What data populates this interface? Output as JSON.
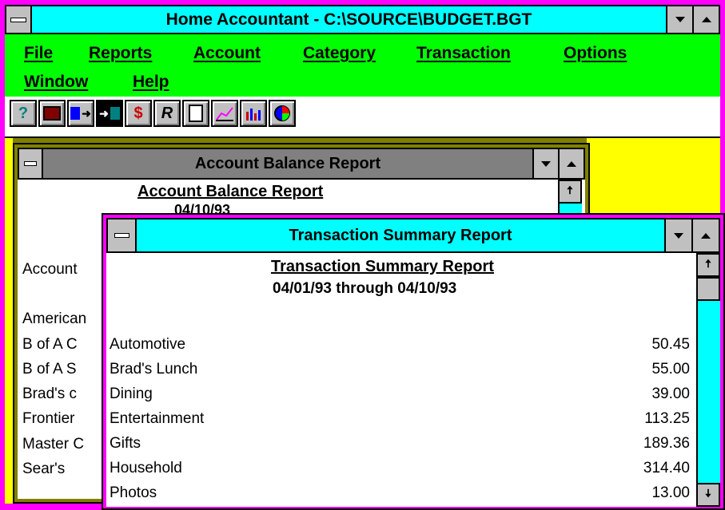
{
  "app": {
    "title": "Home Accountant - C:\\SOURCE\\BUDGET.BGT",
    "menu": [
      "File",
      "Reports",
      "Account",
      "Category",
      "Transaction",
      "Options",
      "Window",
      "Help"
    ],
    "toolbar": [
      "help-icon",
      "save-icon",
      "export-icon",
      "import-icon",
      "dollar-icon",
      "reconcile-icon",
      "report-icon",
      "line-chart-icon",
      "bar-chart-icon",
      "pie-chart-icon"
    ],
    "toolbar_glyphs": [
      "?",
      "",
      "",
      "",
      "$",
      "R",
      "",
      "",
      "",
      ""
    ]
  },
  "account_window": {
    "title": "Account Balance Report",
    "heading": "Account Balance Report",
    "date": "04/10/93",
    "col_label": "Account",
    "rows": [
      "American",
      "B of A C",
      "B of A S",
      "Brad's c",
      "Frontier",
      "Master C",
      "Sear's"
    ]
  },
  "summary_window": {
    "title": "Transaction Summary Report",
    "heading": "Transaction Summary Report",
    "period": "04/01/93 through 04/10/93",
    "rows": [
      {
        "category": "Automotive",
        "amount": "50.45"
      },
      {
        "category": "Brad's Lunch",
        "amount": "55.00"
      },
      {
        "category": "Dining",
        "amount": "39.00"
      },
      {
        "category": "Entertainment",
        "amount": "113.25"
      },
      {
        "category": "Gifts",
        "amount": "189.36"
      },
      {
        "category": "Household",
        "amount": "314.40"
      },
      {
        "category": "Photos",
        "amount": "13.00"
      }
    ]
  },
  "colors": {
    "title_bar": "#00ffff",
    "menu_bar": "#00ff00",
    "desktop": "#ffff00",
    "frame": "#ff00ff"
  }
}
